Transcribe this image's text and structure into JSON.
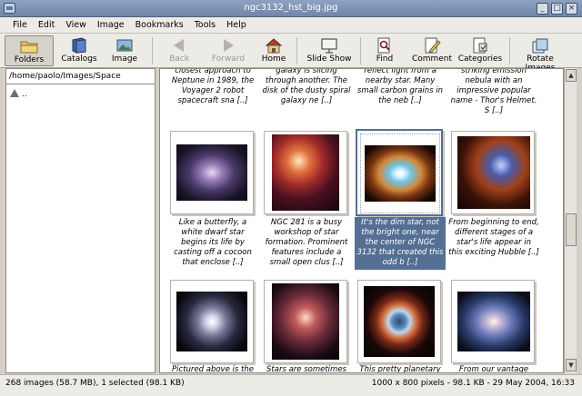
{
  "window": {
    "title": "ngc3132_hst_big.jpg"
  },
  "menu": [
    "File",
    "Edit",
    "View",
    "Image",
    "Bookmarks",
    "Tools",
    "Help"
  ],
  "toolbar": {
    "folders": "Folders",
    "catalogs": "Catalogs",
    "image": "Image",
    "back": "Back",
    "forward": "Forward",
    "home": "Home",
    "slideshow": "Slide Show",
    "find": "Find",
    "comment": "Comment",
    "categories": "Categories",
    "rotate": "Rotate Images"
  },
  "left": {
    "path": "/home/paolo/Images/Space",
    "tree_item": ".."
  },
  "grid": {
    "row0": [
      {
        "caption": "closest approach to Neptune in 1989, the Voyager 2 robot spacecraft sna [..]"
      },
      {
        "caption": "galaxy is slicing through another. The disk of the dusty spiral galaxy ne [..]"
      },
      {
        "caption": "reflect light from a nearby star. Many small carbon grains in the neb [..]"
      },
      {
        "caption": "striking emission nebula with an impressive popular name - Thor's Helmet. S [..]"
      }
    ],
    "row1": [
      {
        "caption": "Like a butterfly, a white dwarf star begins its life by casting off a cocoon that enclose [..]"
      },
      {
        "caption": "NGC 281 is a busy workshop of star formation. Prominent features include a small open clus [..]"
      },
      {
        "caption": "It's the dim star, not the bright one, near the center of NGC 3132 that created this odd b [..]"
      },
      {
        "caption": "From beginning to end, different stages of a star's life appear in this exciting Hubble [..]"
      }
    ],
    "row2": [
      {
        "caption": "Pictured above is the"
      },
      {
        "caption": "Stars are sometimes"
      },
      {
        "caption": "This pretty planetary"
      },
      {
        "caption": "From our vantage"
      }
    ]
  },
  "status": {
    "left": "268 images (58.7 MB), 1 selected (98.1 KB)",
    "right": "1000 x 800 pixels - 98.1 KB - 29 May 2004, 16:33"
  },
  "colors": {
    "selection": "#546f93",
    "titlebar": "#7b90b4"
  }
}
